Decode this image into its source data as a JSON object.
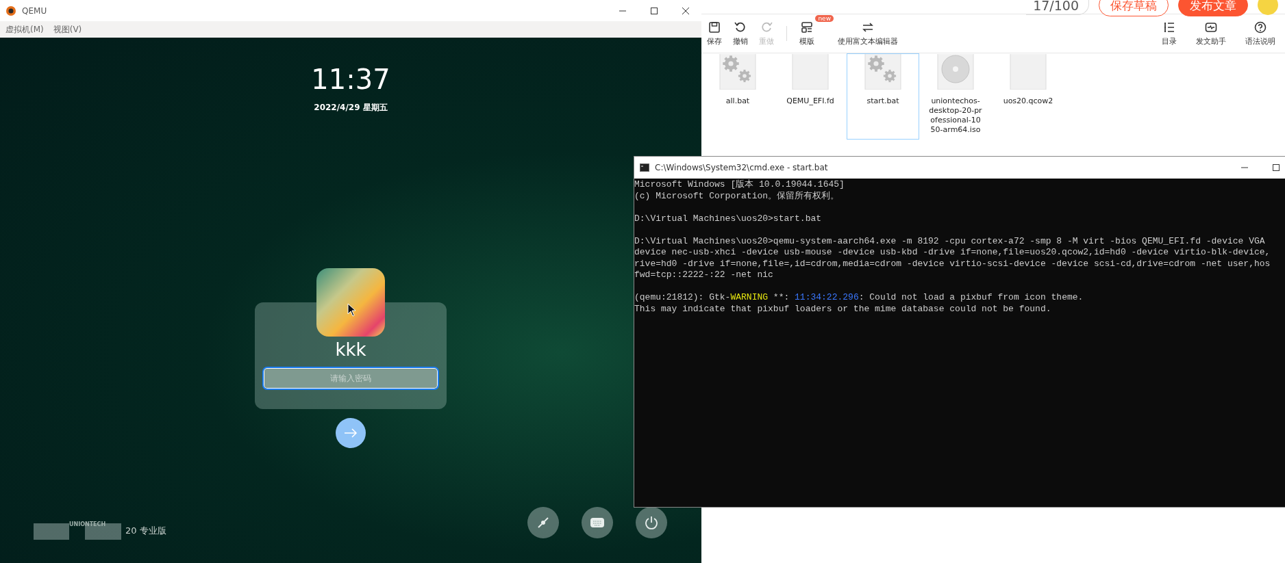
{
  "editor": {
    "word_count": "17/100",
    "buttons": [
      {
        "label": "保存草稿",
        "kind": "outline"
      },
      {
        "label": "发布文章",
        "kind": "primary"
      }
    ],
    "toolbar": [
      {
        "label": "保存",
        "kind": "save",
        "disabled": false
      },
      {
        "label": "撤销",
        "kind": "undo",
        "disabled": false
      },
      {
        "label": "重做",
        "kind": "redo",
        "disabled": true
      },
      {
        "label": "模版",
        "kind": "template",
        "disabled": false,
        "badge": "new"
      },
      {
        "label": "使用富文本编辑器",
        "kind": "switch",
        "disabled": false
      }
    ],
    "toolbar_right": [
      {
        "label": "目录",
        "kind": "list"
      },
      {
        "label": "发文助手",
        "kind": "assistant"
      },
      {
        "label": "语法说明",
        "kind": "help"
      }
    ]
  },
  "file_explorer": {
    "files": [
      {
        "name": "all.bat",
        "kind": "gears",
        "selected": false
      },
      {
        "name": "QEMU_EFI.fd",
        "kind": "blank",
        "selected": false
      },
      {
        "name": "start.bat",
        "kind": "gears",
        "selected": true
      },
      {
        "name": "uniontechos-desktop-20-professional-1050-arm64.iso",
        "kind": "disc",
        "selected": false
      },
      {
        "name": "uos20.qcow2",
        "kind": "blank",
        "selected": false
      }
    ]
  },
  "qemu_window": {
    "title": "QEMU",
    "menu": [
      "虚拟机(M)",
      "视图(V)"
    ],
    "lock_screen": {
      "time": "11:37",
      "date": "2022/4/29 星期五",
      "user_name": "kkk",
      "password_field": {
        "placeholder": "请输入密码"
      },
      "logo_text": "UNIONTECH",
      "edition": "20 专业版"
    }
  },
  "console": {
    "title": "C:\\Windows\\System32\\cmd.exe - start.bat",
    "paragraphs": [
      [
        "Microsoft Windows [版本 10.0.19044.1645]",
        "(c) Microsoft Corporation。保留所有权利。"
      ],
      [
        "D:\\Virtual Machines\\uos20>start.bat"
      ],
      [
        "D:\\Virtual Machines\\uos20>qemu-system-aarch64.exe -m 8192 -cpu cortex-a72 -smp 8 -M virt -bios QEMU_EFI.fd -device VGA",
        "device nec-usb-xhci -device usb-mouse -device usb-kbd -drive if=none,file=uos20.qcow2,id=hd0 -device virtio-blk-device,",
        "rive=hd0 -drive if=none,file=,id=cdrom,media=cdrom -device virtio-scsi-device -device scsi-cd,drive=cdrom -net user,hos",
        "fwd=tcp::2222-:22 -net nic"
      ],
      [
        [
          {
            "text": "(qemu:21812): Gtk-",
            "kind": "plain"
          },
          {
            "text": "WARNING",
            "kind": "warning"
          },
          {
            "text": " **: ",
            "kind": "plain"
          },
          {
            "text": "11:34:22.296",
            "kind": "timestamp"
          },
          {
            "text": ": Could not load a pixbuf from icon theme.",
            "kind": "plain"
          }
        ],
        "This may indicate that pixbuf loaders or the mime database could not be found."
      ]
    ]
  }
}
